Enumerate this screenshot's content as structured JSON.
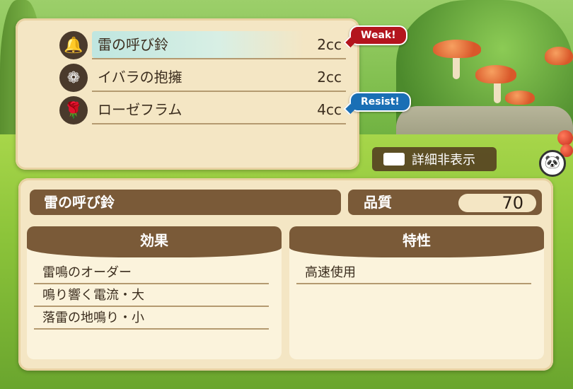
{
  "skills": [
    {
      "name": "雷の呼び鈴",
      "cost": "2cc",
      "icon": "bell-icon",
      "selected": true,
      "badge": "Weak!"
    },
    {
      "name": "イバラの抱擁",
      "cost": "2cc",
      "icon": "thorn-wreath-icon",
      "selected": false,
      "badge": ""
    },
    {
      "name": "ローゼフラム",
      "cost": "4cc",
      "icon": "rose-flame-icon",
      "selected": false,
      "badge": "Resist!"
    }
  ],
  "toggle": {
    "label": "詳細非表示"
  },
  "detail": {
    "title": "雷の呼び鈴",
    "quality_label": "品質",
    "quality_value": "70",
    "effects_header": "効果",
    "effects": [
      "雷鳴のオーダー",
      "鳴り響く電流・大",
      "落雷の地鳴り・小"
    ],
    "traits_header": "特性",
    "traits": [
      "高速使用"
    ]
  },
  "colors": {
    "weak": "#b3141d",
    "resist": "#1a6fb5",
    "panel": "#f4e6c4",
    "header": "#7a5a38"
  }
}
